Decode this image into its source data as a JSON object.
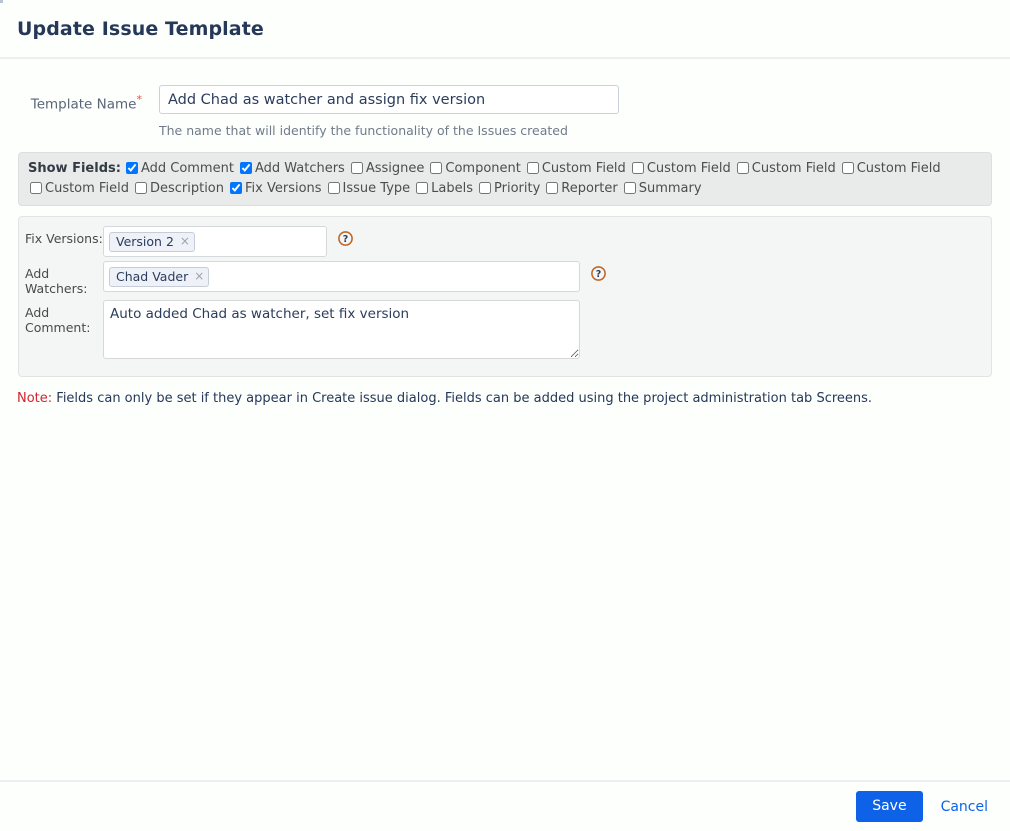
{
  "header": {
    "title": "Update Issue Template"
  },
  "form": {
    "template_name": {
      "label": "Template Name",
      "required_marker": "*",
      "value": "Add Chad as watcher and assign fix version",
      "placeholder": "",
      "description": "The name that will identify the functionality of the Issues created"
    }
  },
  "show_fields": {
    "title": "Show Fields:",
    "items": [
      {
        "label": "Add Comment",
        "checked": true
      },
      {
        "label": "Add Watchers",
        "checked": true
      },
      {
        "label": "Assignee",
        "checked": false
      },
      {
        "label": "Component",
        "checked": false
      },
      {
        "label": "Custom Field",
        "checked": false
      },
      {
        "label": "Custom Field",
        "checked": false
      },
      {
        "label": "Custom Field",
        "checked": false
      },
      {
        "label": "Custom Field",
        "checked": false
      },
      {
        "label": "Custom Field",
        "checked": false
      },
      {
        "label": "Description",
        "checked": false
      },
      {
        "label": "Fix Versions",
        "checked": true
      },
      {
        "label": "Issue Type",
        "checked": false
      },
      {
        "label": "Labels",
        "checked": false
      },
      {
        "label": "Priority",
        "checked": false
      },
      {
        "label": "Reporter",
        "checked": false
      },
      {
        "label": "Summary",
        "checked": false
      }
    ]
  },
  "fields": {
    "fix_versions": {
      "label": "Fix Versions:",
      "tokens": [
        "Version 2"
      ],
      "remove_glyph": "×",
      "help_icon": "help-circle-icon"
    },
    "add_watchers": {
      "label": "Add Watchers:",
      "tokens": [
        "Chad Vader"
      ],
      "remove_glyph": "×",
      "help_icon": "help-circle-icon"
    },
    "add_comment": {
      "label": "Add Comment:",
      "value": "Auto added Chad as watcher, set fix version",
      "placeholder": ""
    }
  },
  "note": {
    "tag": "Note:",
    "text": " Fields can only be set if they appear in Create issue dialog. Fields can be added using the project administration tab Screens."
  },
  "footer": {
    "save_label": "Save",
    "cancel_label": "Cancel"
  },
  "colors": {
    "accent": "#0d62e8",
    "required": "#e8502a",
    "note": "#d1242f",
    "title": "#253858",
    "panel_bg": "#e9eaea",
    "fields_bg": "#f4f5f5"
  }
}
